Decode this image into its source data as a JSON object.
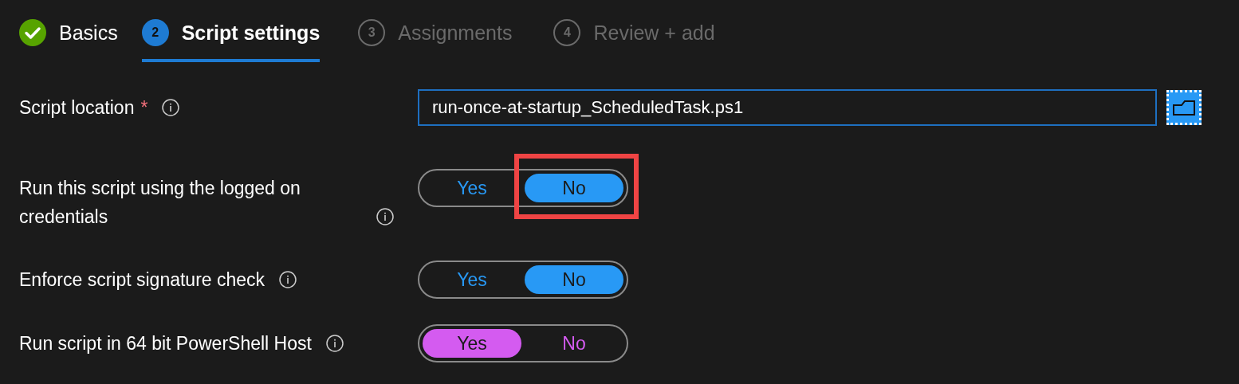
{
  "steps": [
    {
      "label": "Basics",
      "completed": true,
      "selected": false
    },
    {
      "number": "2",
      "label": "Script settings",
      "completed": false,
      "selected": true
    },
    {
      "number": "3",
      "label": "Assignments",
      "completed": false,
      "selected": false
    },
    {
      "number": "4",
      "label": "Review + add",
      "completed": false,
      "selected": false
    }
  ],
  "script_location": {
    "label": "Script location",
    "required_mark": "*",
    "value": "run-once-at-startup_ScheduledTask.ps1"
  },
  "toggles": [
    {
      "label": "Run this script using the logged on credentials",
      "color": "#2899f5",
      "highlighted": true,
      "options": [
        {
          "label": "Yes",
          "selected": false
        },
        {
          "label": "No",
          "selected": true
        }
      ]
    },
    {
      "label": "Enforce script signature check",
      "color": "#2899f5",
      "highlighted": false,
      "options": [
        {
          "label": "Yes",
          "selected": false
        },
        {
          "label": "No",
          "selected": true
        }
      ]
    },
    {
      "label": "Run script in 64 bit PowerShell Host",
      "color": "#d45bf0",
      "highlighted": false,
      "options": [
        {
          "label": "Yes",
          "selected": true
        },
        {
          "label": "No",
          "selected": false
        }
      ]
    }
  ]
}
